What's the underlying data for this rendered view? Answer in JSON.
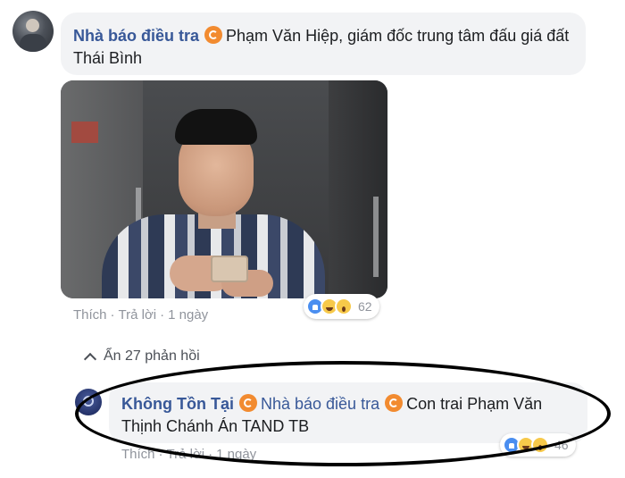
{
  "post_comment": {
    "author": "Nhà báo điều tra",
    "tag_icon": "at-mention-icon",
    "text": "Phạm Văn Hiệp, giám đốc trung tâm đấu giá đất Thái Bình",
    "reactions": {
      "icons": [
        "like",
        "haha",
        "wow"
      ],
      "count": "62"
    },
    "actions": {
      "like": "Thích",
      "reply": "Trả lời",
      "time": "1 ngày"
    }
  },
  "replies_toggle": {
    "label": "Ẩn 27 phản hồi",
    "icon": "chevron-up-icon"
  },
  "reply_comment": {
    "author": "Không Tồn Tại",
    "tagged_user": "Nhà báo điều tra",
    "text": "Con trai Phạm Văn Thịnh Chánh Án TAND TB",
    "reactions": {
      "icons": [
        "like",
        "haha",
        "wow"
      ],
      "count": "46"
    },
    "actions": {
      "like": "Thích",
      "reply": "Trả lời",
      "time": "1 ngày"
    }
  },
  "colors": {
    "name_link": "#385898",
    "bubble_bg": "#f2f3f5",
    "meta_text": "#90949c",
    "tag_badge": "#f28b30",
    "highlight_ellipse": "#000000"
  }
}
